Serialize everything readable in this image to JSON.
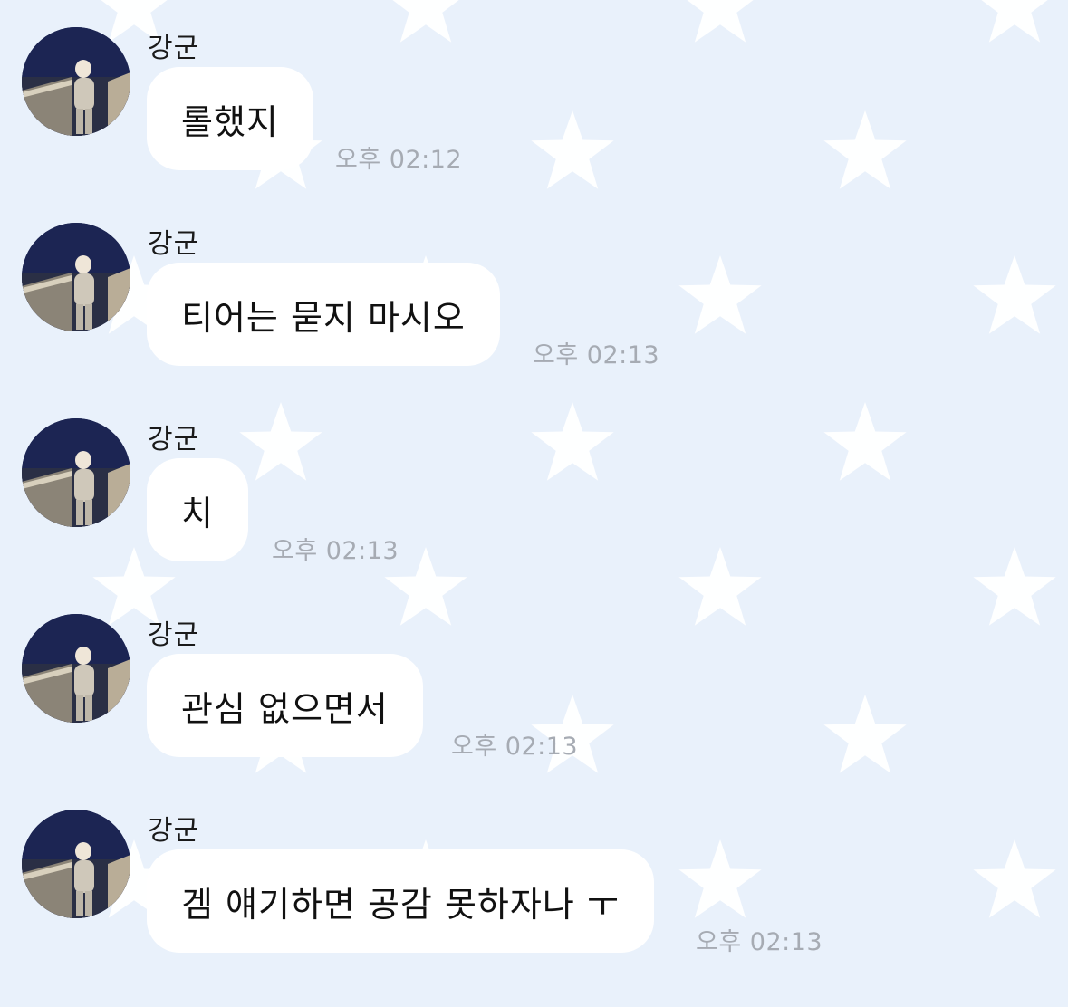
{
  "colors": {
    "background": "#e9f1fb",
    "bubble": "#ffffff",
    "star": "#ffffff",
    "timestamp": "#a6abb3"
  },
  "messages": [
    {
      "sender": "강군",
      "text": "롤했지",
      "time": "오후 02:12",
      "avatar": "profile-photo-icon"
    },
    {
      "sender": "강군",
      "text": "티어는 묻지 마시오",
      "time": "오후 02:13",
      "avatar": "profile-photo-icon"
    },
    {
      "sender": "강군",
      "text": "치",
      "time": "오후 02:13",
      "avatar": "profile-photo-icon"
    },
    {
      "sender": "강군",
      "text": "관심 없으면서",
      "time": "오후 02:13",
      "avatar": "profile-photo-icon"
    },
    {
      "sender": "강군",
      "text": "겜 얘기하면 공감 못하자나 ㅜ",
      "time": "오후 02:13",
      "avatar": "profile-photo-icon"
    }
  ]
}
